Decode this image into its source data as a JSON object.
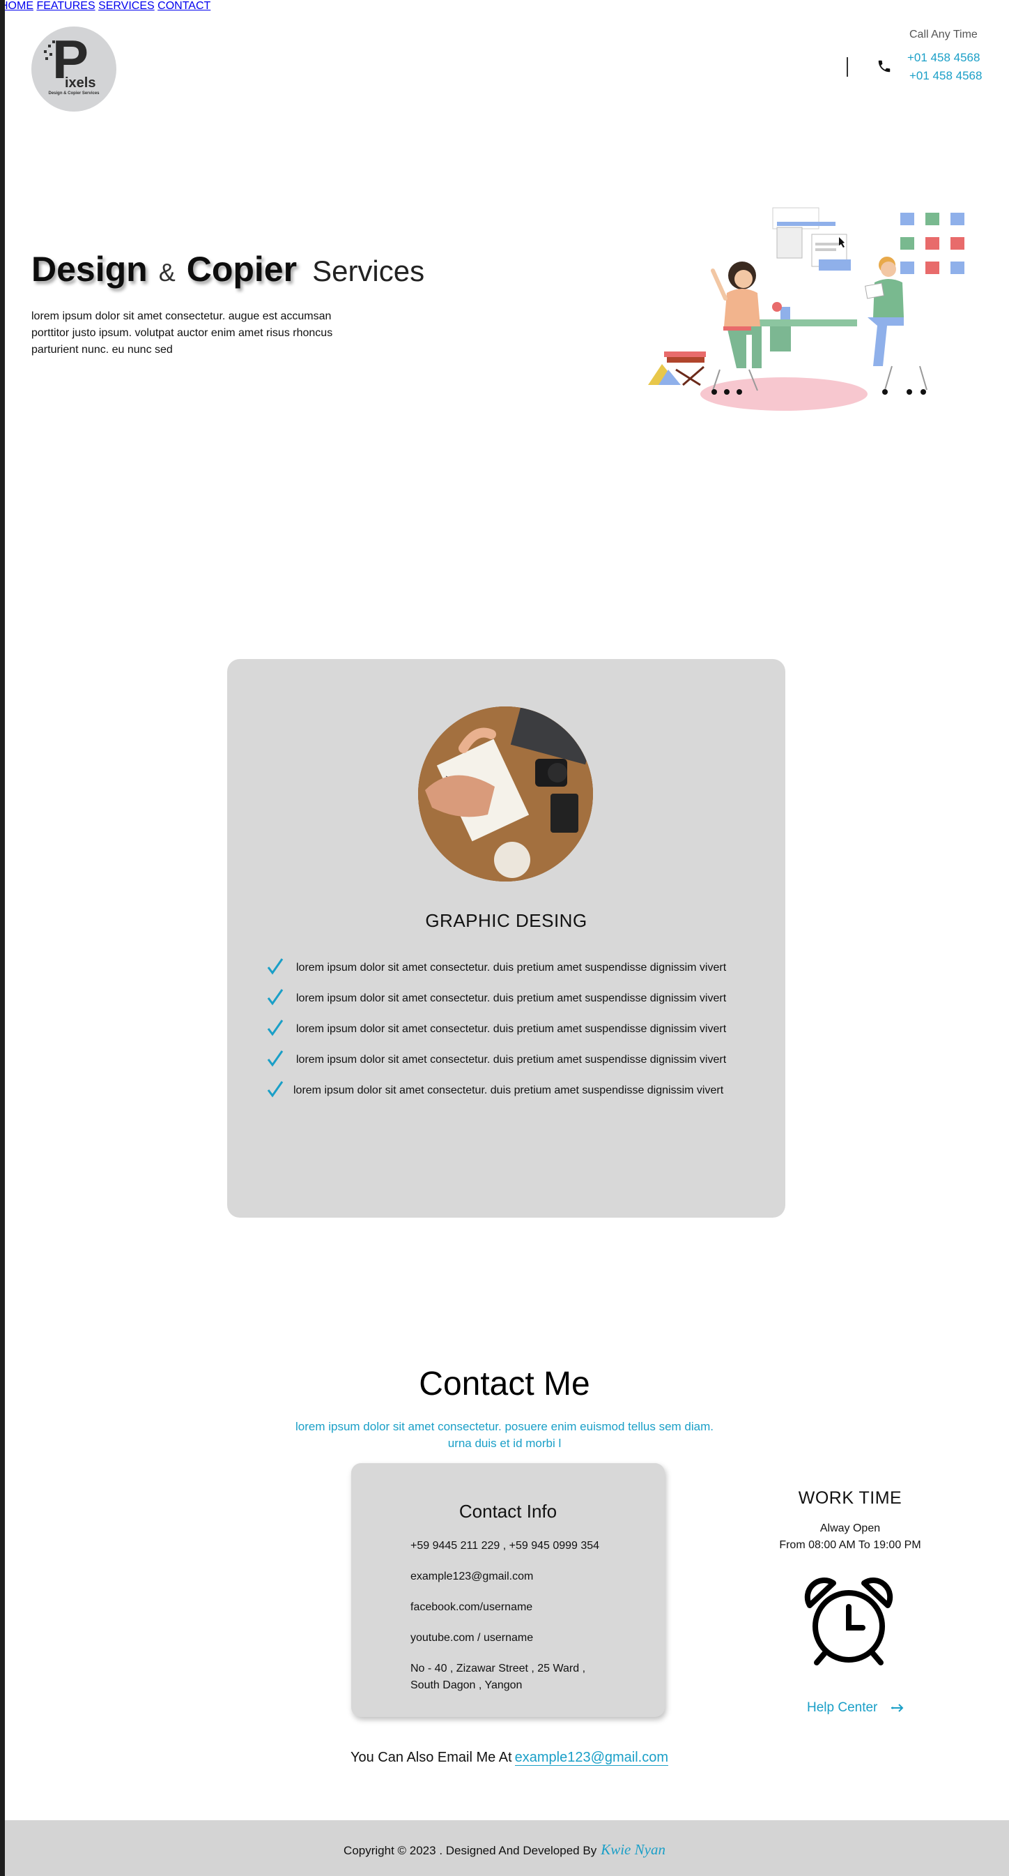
{
  "brand": {
    "logo_letter": "P",
    "logo_name": "ixels",
    "logo_tagline": "Design & Copier Services"
  },
  "nav": {
    "items": [
      {
        "label": "HOME"
      },
      {
        "label": "FEATURES"
      },
      {
        "label": "SERVICES"
      },
      {
        "label": "CONTACT"
      }
    ],
    "call_label": "Call Any Time",
    "phone_1": "+01 458 4568",
    "phone_2": "+01 458 4568"
  },
  "hero": {
    "title_word_1": "Design",
    "title_amp": "&",
    "title_word_2": "Copier",
    "title_word_3": "Services",
    "text": "lorem ipsum dolor sit amet consectetur. augue est accumsan porttitor justo ipsum. volutpat auctor enim amet risus rhoncus parturient nunc. eu nunc sed"
  },
  "service": {
    "title": "GRAPHIC DESING",
    "features": [
      "lorem ipsum dolor sit amet consectetur. duis pretium amet suspendisse dignissim vivert",
      "lorem ipsum dolor sit amet consectetur. duis pretium amet suspendisse dignissim vivert",
      "lorem ipsum dolor sit amet consectetur. duis pretium amet suspendisse dignissim vivert",
      "lorem ipsum dolor sit amet consectetur. duis pretium amet suspendisse dignissim vivert",
      "lorem ipsum dolor sit amet consectetur. duis pretium amet suspendisse dignissim vivert"
    ]
  },
  "contact": {
    "title": "Contact Me",
    "subtitle": "lorem ipsum dolor sit amet consectetur. posuere enim euismod tellus sem diam. urna duis et id morbi l",
    "info_title": "Contact Info",
    "phones": "+59 9445 211 229 ,  +59  945 0999 354",
    "email": "example123@gmail.com",
    "facebook": "facebook.com/username",
    "youtube": "youtube.com / username",
    "address_1": "No - 40 , Zizawar Street , 25 Ward ,",
    "address_2": "South Dagon , Yangon",
    "work_title": "WORK TIME",
    "work_status": "Alway Open",
    "work_hours": "From 08:00 AM To 19:00 PM",
    "help_label": "Help Center",
    "email_prompt": "You Can Also Email Me At",
    "email_link": "example123@gmail.com"
  },
  "footer": {
    "text": "Copyright © 2023 . Designed And Developed By",
    "author": "Kwie Nyan"
  },
  "colors": {
    "accent": "#1a9fc7",
    "card_bg": "#d8d8d8",
    "footer_bg": "#d4d4d4"
  },
  "icons": [
    "phone-icon",
    "check-icon",
    "alarm-clock-icon",
    "arrow-right-icon"
  ]
}
